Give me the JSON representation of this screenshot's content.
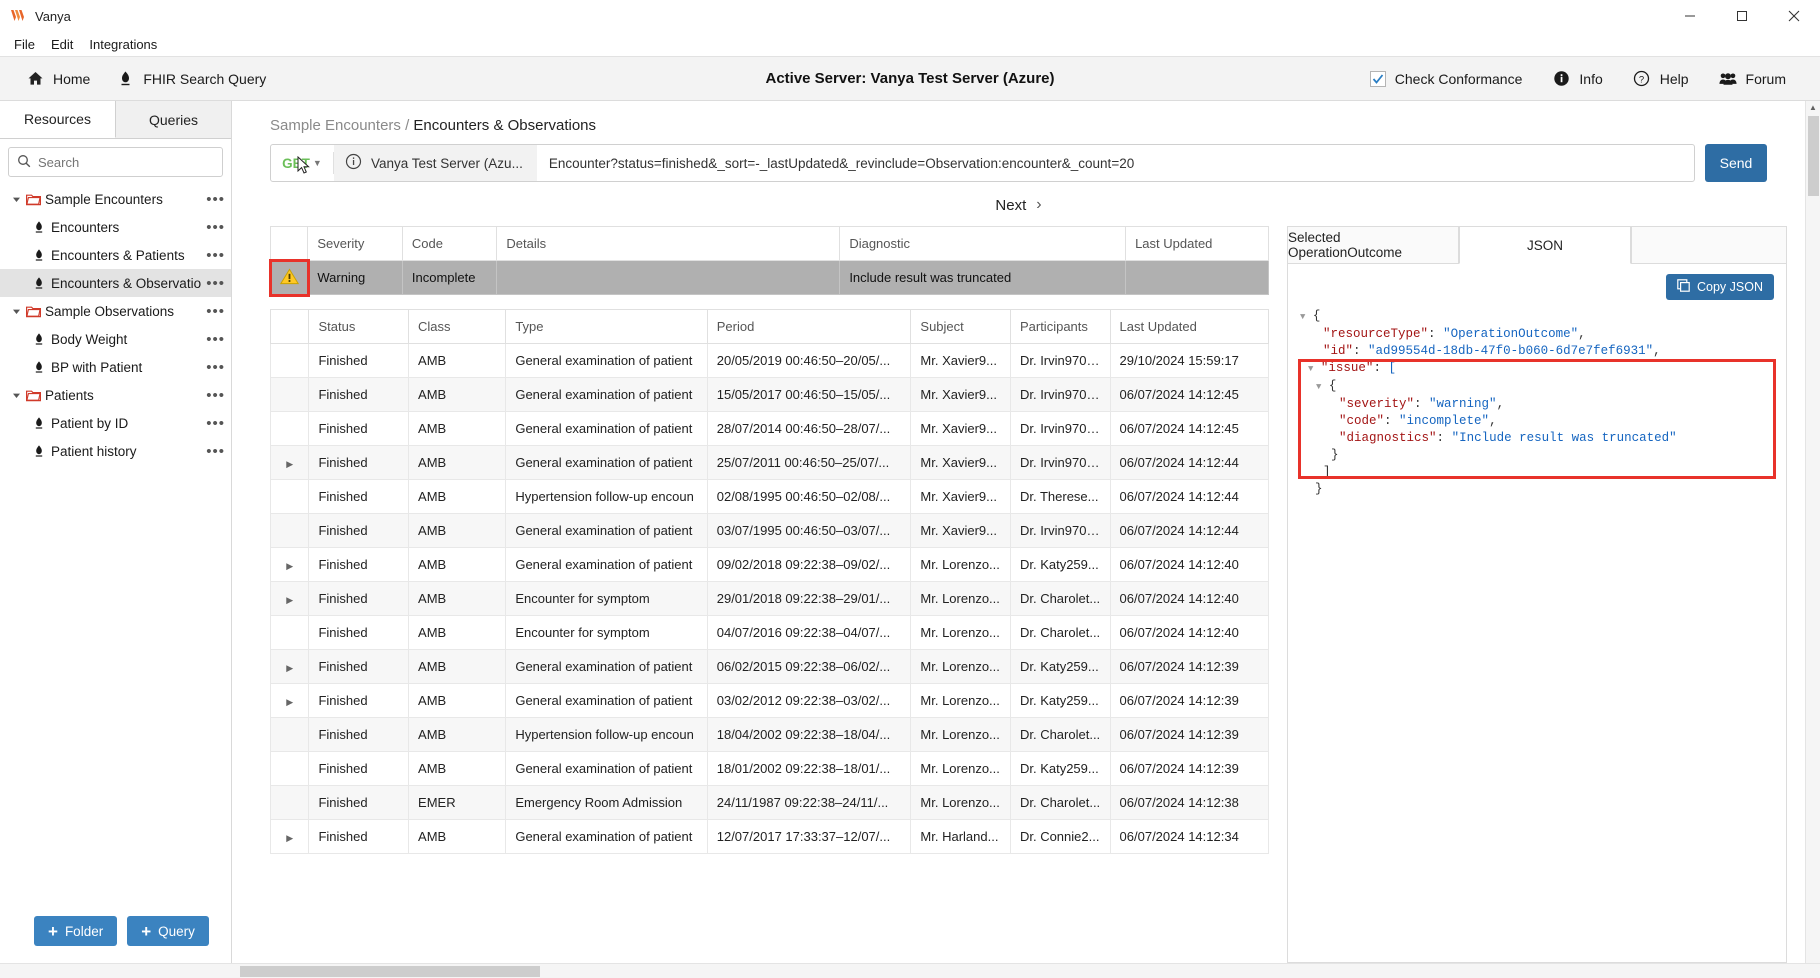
{
  "window": {
    "app_title": "Vanya",
    "minimize": "─",
    "maximize": "☐",
    "close": "✕"
  },
  "menu": {
    "items": [
      "File",
      "Edit",
      "Integrations"
    ]
  },
  "ribbon": {
    "home_label": "Home",
    "fhir_label": "FHIR Search Query",
    "active_server": "Active Server: Vanya Test Server (Azure)",
    "check_conformance": "Check Conformance",
    "info_label": "Info",
    "help_label": "Help",
    "forum_label": "Forum"
  },
  "sidebar": {
    "tabs": [
      {
        "label": "Resources",
        "active": true
      },
      {
        "label": "Queries",
        "active": false
      }
    ],
    "search_placeholder": "Search",
    "search_value": "",
    "tree": [
      {
        "label": "Sample Encounters",
        "type": "folder",
        "selected": false
      },
      {
        "label": "Encounters",
        "type": "leaf",
        "selected": false
      },
      {
        "label": "Encounters & Patients",
        "type": "leaf",
        "selected": false
      },
      {
        "label": "Encounters & Observations",
        "type": "leaf",
        "selected": true
      },
      {
        "label": "Sample Observations",
        "type": "folder",
        "selected": false
      },
      {
        "label": "Body Weight",
        "type": "leaf",
        "selected": false
      },
      {
        "label": "BP with Patient",
        "type": "leaf",
        "selected": false
      },
      {
        "label": "Patients",
        "type": "folder",
        "selected": false
      },
      {
        "label": "Patient by ID",
        "type": "leaf",
        "selected": false
      },
      {
        "label": "Patient history",
        "type": "leaf",
        "selected": false
      }
    ],
    "more_dots": "•••",
    "folder_button": "Folder",
    "query_button": "Query",
    "plus": "+"
  },
  "main": {
    "breadcrumb_parent": "Sample Encounters",
    "breadcrumb_sep": "/",
    "breadcrumb_current": "Encounters & Observations",
    "query": {
      "method": "GET",
      "server": "Vanya Test Server (Azu...",
      "path": "Encounter?status=finished&_sort=-_lastUpdated&_revinclude=Observation:encounter&_count=20",
      "send_label": "Send"
    },
    "next_label": "Next",
    "next_arrow": "›"
  },
  "outcome_table": {
    "columns": [
      "",
      "Severity",
      "Code",
      "Details",
      "Diagnostic",
      "Last Updated"
    ],
    "rows": [
      {
        "icon": "warning-triangle-icon",
        "severity": "Warning",
        "code": "Incomplete",
        "details": "",
        "diagnostic": "Include result was truncated",
        "last_updated": ""
      }
    ]
  },
  "encounters_table": {
    "columns": [
      "",
      "Status",
      "Class",
      "Type",
      "Period",
      "Subject",
      "Participants",
      "Last Updated"
    ],
    "rows": [
      {
        "expand": false,
        "status": "Finished",
        "class": "AMB",
        "type": "General examination of patient",
        "period": "20/05/2019 00:46:50–20/05/...",
        "subject": "Mr. Xavier9...",
        "participants": "Dr. Irvin970 ...",
        "last_updated": "29/10/2024 15:59:17"
      },
      {
        "expand": false,
        "status": "Finished",
        "class": "AMB",
        "type": "General examination of patient",
        "period": "15/05/2017 00:46:50–15/05/...",
        "subject": "Mr. Xavier9...",
        "participants": "Dr. Irvin970 ...",
        "last_updated": "06/07/2024 14:12:45"
      },
      {
        "expand": false,
        "status": "Finished",
        "class": "AMB",
        "type": "General examination of patient",
        "period": "28/07/2014 00:46:50–28/07/...",
        "subject": "Mr. Xavier9...",
        "participants": "Dr. Irvin970 ...",
        "last_updated": "06/07/2024 14:12:45"
      },
      {
        "expand": true,
        "status": "Finished",
        "class": "AMB",
        "type": "General examination of patient",
        "period": "25/07/2011 00:46:50–25/07/...",
        "subject": "Mr. Xavier9...",
        "participants": "Dr. Irvin970 ...",
        "last_updated": "06/07/2024 14:12:44"
      },
      {
        "expand": false,
        "status": "Finished",
        "class": "AMB",
        "type": "Hypertension follow-up encoun",
        "period": "02/08/1995 00:46:50–02/08/...",
        "subject": "Mr. Xavier9...",
        "participants": "Dr. Therese...",
        "last_updated": "06/07/2024 14:12:44"
      },
      {
        "expand": false,
        "status": "Finished",
        "class": "AMB",
        "type": "General examination of patient",
        "period": "03/07/1995 00:46:50–03/07/...",
        "subject": "Mr. Xavier9...",
        "participants": "Dr. Irvin970 ...",
        "last_updated": "06/07/2024 14:12:44"
      },
      {
        "expand": true,
        "status": "Finished",
        "class": "AMB",
        "type": "General examination of patient",
        "period": "09/02/2018 09:22:38–09/02/...",
        "subject": "Mr. Lorenzo...",
        "participants": "Dr. Katy259...",
        "last_updated": "06/07/2024 14:12:40"
      },
      {
        "expand": true,
        "status": "Finished",
        "class": "AMB",
        "type": "Encounter for symptom",
        "period": "29/01/2018 09:22:38–29/01/...",
        "subject": "Mr. Lorenzo...",
        "participants": "Dr. Charolet...",
        "last_updated": "06/07/2024 14:12:40"
      },
      {
        "expand": false,
        "status": "Finished",
        "class": "AMB",
        "type": "Encounter for symptom",
        "period": "04/07/2016 09:22:38–04/07/...",
        "subject": "Mr. Lorenzo...",
        "participants": "Dr. Charolet...",
        "last_updated": "06/07/2024 14:12:40"
      },
      {
        "expand": true,
        "status": "Finished",
        "class": "AMB",
        "type": "General examination of patient",
        "period": "06/02/2015 09:22:38–06/02/...",
        "subject": "Mr. Lorenzo...",
        "participants": "Dr. Katy259...",
        "last_updated": "06/07/2024 14:12:39"
      },
      {
        "expand": true,
        "status": "Finished",
        "class": "AMB",
        "type": "General examination of patient",
        "period": "03/02/2012 09:22:38–03/02/...",
        "subject": "Mr. Lorenzo...",
        "participants": "Dr. Katy259...",
        "last_updated": "06/07/2024 14:12:39"
      },
      {
        "expand": false,
        "status": "Finished",
        "class": "AMB",
        "type": "Hypertension follow-up encoun",
        "period": "18/04/2002 09:22:38–18/04/...",
        "subject": "Mr. Lorenzo...",
        "participants": "Dr. Charolet...",
        "last_updated": "06/07/2024 14:12:39"
      },
      {
        "expand": false,
        "status": "Finished",
        "class": "AMB",
        "type": "General examination of patient",
        "period": "18/01/2002 09:22:38–18/01/...",
        "subject": "Mr. Lorenzo...",
        "participants": "Dr. Katy259...",
        "last_updated": "06/07/2024 14:12:39"
      },
      {
        "expand": false,
        "status": "Finished",
        "class": "EMER",
        "type": "Emergency Room Admission",
        "period": "24/11/1987 09:22:38–24/11/...",
        "subject": "Mr. Lorenzo...",
        "participants": "Dr. Charolet...",
        "last_updated": "06/07/2024 14:12:38"
      },
      {
        "expand": true,
        "status": "Finished",
        "class": "AMB",
        "type": "General examination of patient",
        "period": "12/07/2017 17:33:37–12/07/...",
        "subject": "Mr. Harland...",
        "participants": "Dr. Connie2...",
        "last_updated": "06/07/2024 14:12:34"
      }
    ]
  },
  "right_panel": {
    "tabs": [
      {
        "label": "Selected OperationOutcome",
        "active": false
      },
      {
        "label": "JSON",
        "active": true
      }
    ],
    "copy_label": "Copy JSON",
    "json_lines": [
      {
        "indent": 0,
        "caret": "▼",
        "text": "{",
        "kind": "pun"
      },
      {
        "indent": 1,
        "key": "\"resourceType\"",
        "value": "\"OperationOutcome\"",
        "tail": ","
      },
      {
        "indent": 1,
        "key": "\"id\"",
        "value": "\"ad99554d-18db-47f0-b060-6d7e7fef6931\"",
        "tail": ","
      },
      {
        "indent": 1,
        "caret": "▼",
        "key": "\"issue\"",
        "value": "[",
        "tail": ""
      },
      {
        "indent": 2,
        "caret": "▼",
        "text": "{",
        "kind": "pun"
      },
      {
        "indent": 3,
        "key": "\"severity\"",
        "value": "\"warning\"",
        "tail": ","
      },
      {
        "indent": 3,
        "key": "\"code\"",
        "value": "\"incomplete\"",
        "tail": ","
      },
      {
        "indent": 3,
        "key": "\"diagnostics\"",
        "value": "\"Include result was truncated\"",
        "tail": ""
      },
      {
        "indent": 2,
        "text": "}",
        "kind": "pun"
      },
      {
        "indent": 1,
        "text": "]",
        "kind": "pun"
      },
      {
        "indent": 0,
        "text": "}",
        "kind": "pun"
      }
    ]
  },
  "colors": {
    "accent_blue": "#2e6da4",
    "link_blue": "#2a6dbf",
    "get_green": "#6bbf59",
    "warning_yellow": "#ffc107",
    "highlight_red": "#e8322a",
    "outcome_row_gray": "#b0b0b0"
  }
}
